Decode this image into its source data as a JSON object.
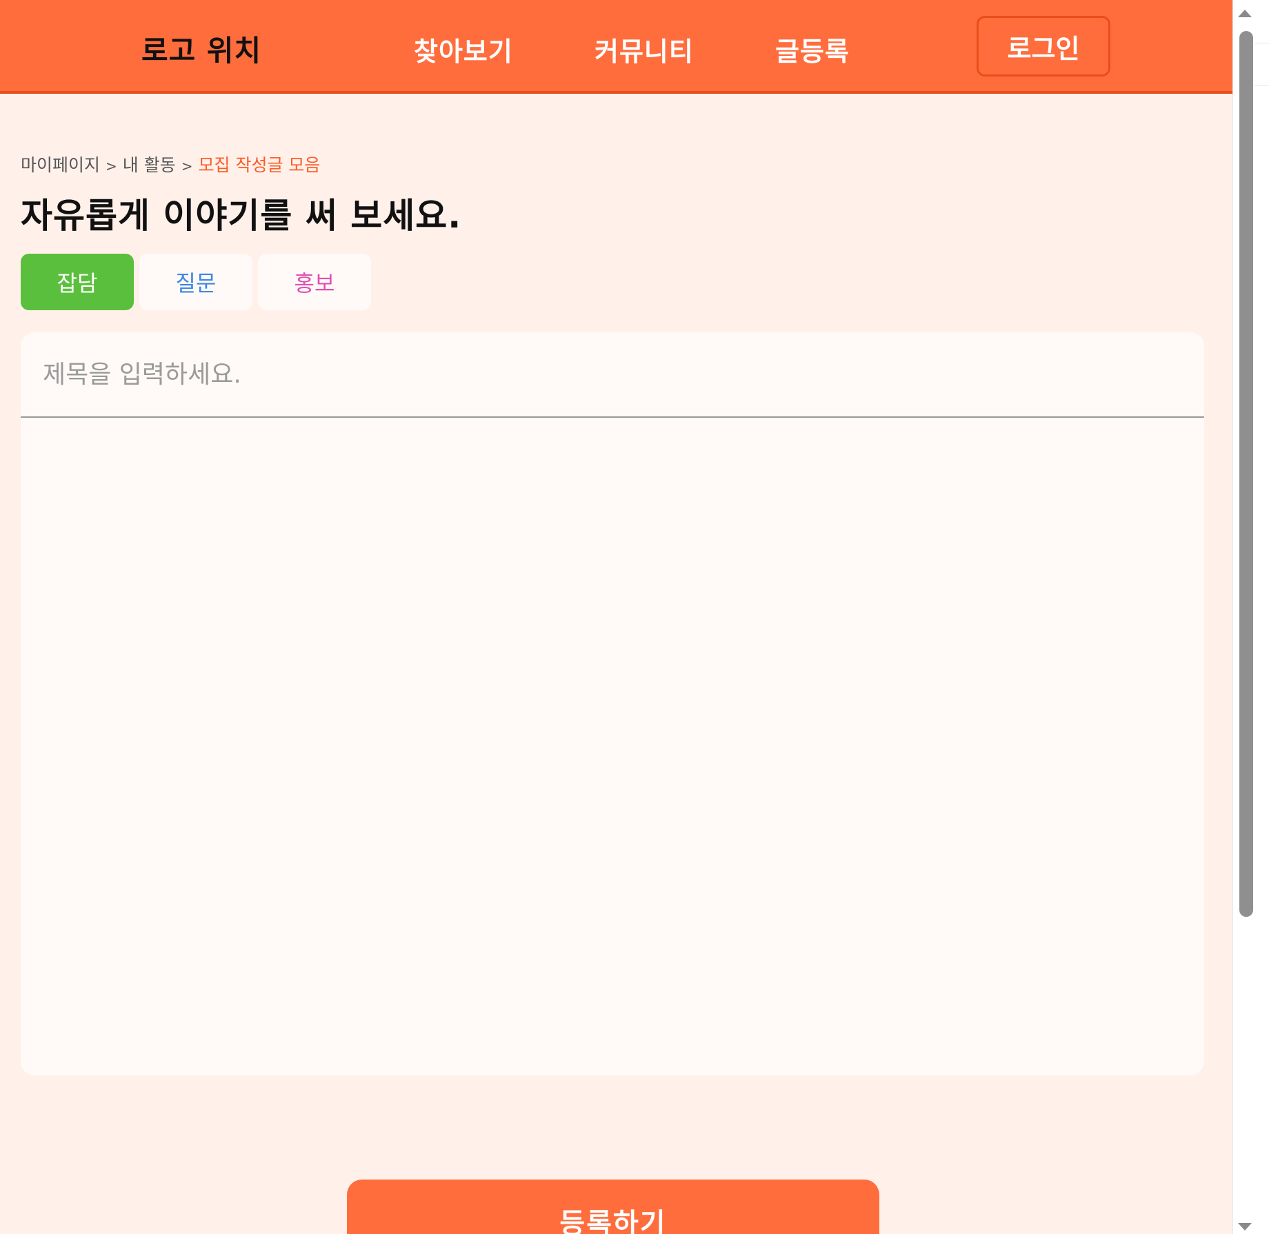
{
  "header": {
    "logo": "로고 위치",
    "nav": {
      "explore": "찾아보기",
      "community": "커뮤니티",
      "write": "글등록"
    },
    "login_label": "로그인"
  },
  "breadcrumb": {
    "items": [
      "마이페이지",
      "내 활동",
      "모집 작성글 모음"
    ],
    "separator": ">"
  },
  "page_title": "자유롭게 이야기를 써 보세요.",
  "tabs": [
    {
      "label": "잡담",
      "color": "#5bbf3e",
      "selected": true
    },
    {
      "label": "질문",
      "color": "#3e86e6",
      "selected": false
    },
    {
      "label": "홍보",
      "color": "#e04fb3",
      "selected": false
    }
  ],
  "editor": {
    "title_placeholder": "제목을 입력하세요.",
    "title_value": "",
    "body_value": ""
  },
  "submit_label": "등록하기",
  "colors": {
    "brand": "#ff6d3d",
    "brand_dark": "#e94e1a",
    "background": "#fff0ea",
    "breadcrumb_current": "#ff5a25"
  },
  "icons": {
    "scroll_up": "scroll-up-arrow-icon",
    "scroll_down": "scroll-down-arrow-icon"
  }
}
